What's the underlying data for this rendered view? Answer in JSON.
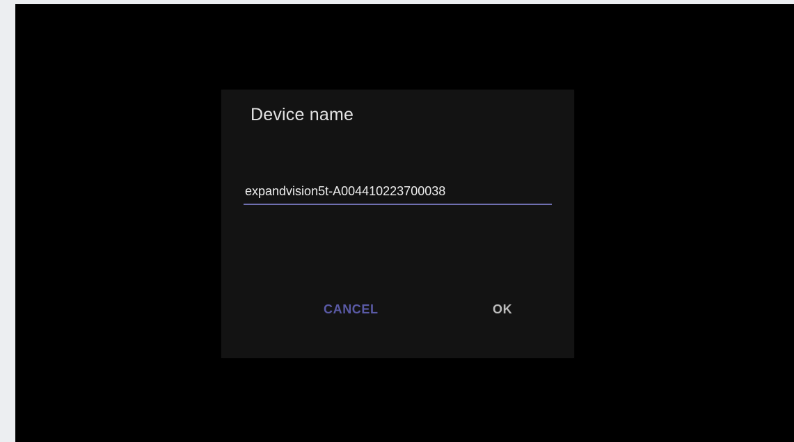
{
  "dialog": {
    "title": "Device name",
    "input_value": "expandvision5t-A004410223700038",
    "cancel_label": "CANCEL",
    "ok_label": "OK"
  },
  "colors": {
    "screen_background": "#000000",
    "dialog_background": "#131313",
    "accent": "#6f6fb0",
    "cancel_text": "#5a5aa6",
    "ok_text": "#bdbdbd"
  }
}
